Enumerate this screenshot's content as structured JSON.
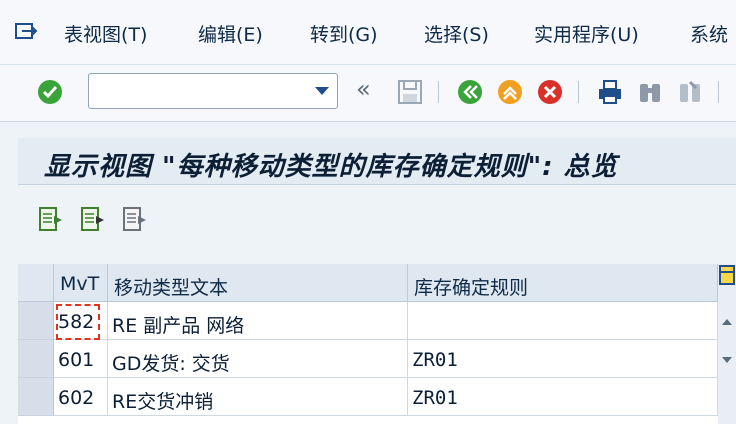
{
  "menu": {
    "items": [
      {
        "label": "表视图(T)"
      },
      {
        "label": "编辑(E)"
      },
      {
        "label": "转到(G)"
      },
      {
        "label": "选择(S)"
      },
      {
        "label": "实用程序(U)"
      },
      {
        "label": "系统"
      }
    ]
  },
  "toolbar": {
    "command_value": "",
    "back_glyph": "«"
  },
  "screen": {
    "title": "显示视图 \"每种移动类型的库存确定规则\": 总览"
  },
  "table": {
    "columns": [
      "MvT",
      "移动类型文本",
      "库存确定规则"
    ],
    "rows": [
      {
        "mvt": "582",
        "text": "RE 副产品   网络",
        "rule": ""
      },
      {
        "mvt": "601",
        "text": "GD发货: 交货",
        "rule": "ZR01"
      },
      {
        "mvt": "602",
        "text": "RE交货冲销",
        "rule": "ZR01"
      }
    ]
  },
  "colors": {
    "accent": "#0f2a48",
    "ok_green": "#3aa33a",
    "cancel_red": "#d9302b",
    "exit_orange": "#f0a020"
  }
}
